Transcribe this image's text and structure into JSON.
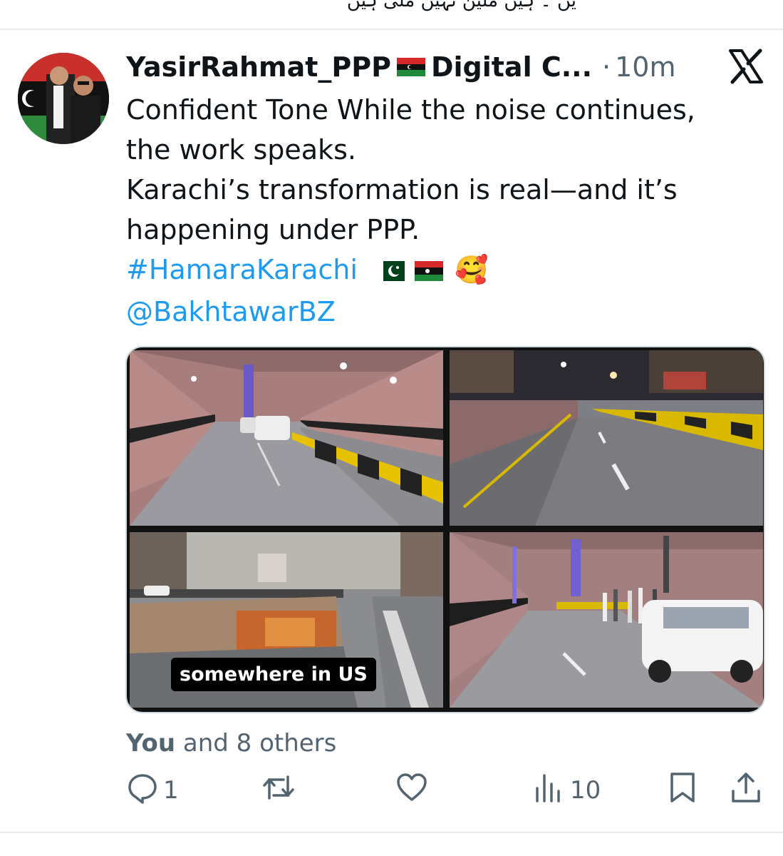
{
  "top_strip": {
    "partial_text": "یں ۔ ہیں ملین نہیں ملی ہیں"
  },
  "tweet": {
    "author": "YasirRahmat_PPP",
    "author_suffix": "Digital C...",
    "separator": "·",
    "time": "10m",
    "lines": [
      "Confident Tone While the noise continues,",
      "the work speaks.",
      "Karachi’s transformation is real—and it’s",
      "happening under PPP."
    ],
    "hashtag": "#HamaraKarachi",
    "emoji": "🥰",
    "mention": "@BakhtawarBZ",
    "media_caption": "somewhere in US"
  },
  "engagement": {
    "likes_you": "You",
    "likes_rest": " and 8 others",
    "reply_count": "1",
    "views_count": "10"
  },
  "colors": {
    "link": "#1d9bf0",
    "muted": "#536471",
    "text": "#0f1419",
    "divider": "#e8ebed"
  },
  "icons": [
    "x-logo-icon",
    "reply-icon",
    "retweet-icon",
    "like-icon",
    "views-icon",
    "bookmark-icon",
    "share-icon"
  ]
}
